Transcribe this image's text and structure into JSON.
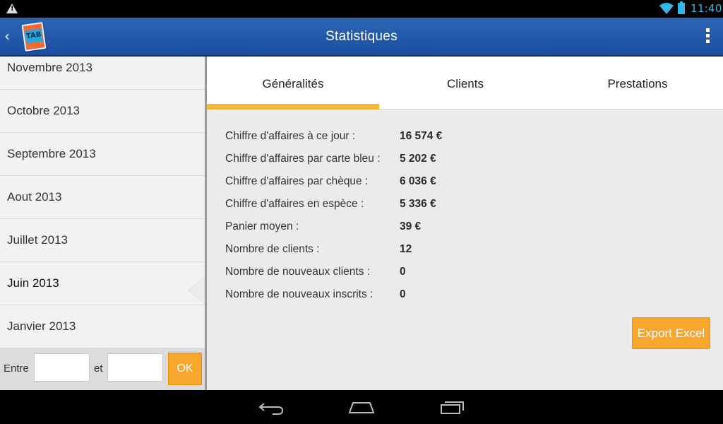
{
  "status_bar": {
    "time": "11:40",
    "icons": [
      "warning-icon",
      "wifi-icon",
      "battery-icon"
    ],
    "accent": "#33b5e5"
  },
  "action_bar": {
    "title": "Statistiques",
    "logo_text": "TAB",
    "colors": {
      "background": "#2559aa"
    }
  },
  "sidebar": {
    "months": [
      {
        "label": "Novembre 2013"
      },
      {
        "label": "Octobre 2013"
      },
      {
        "label": "Septembre 2013"
      },
      {
        "label": "Aout 2013"
      },
      {
        "label": "Juillet 2013"
      },
      {
        "label": "Juin 2013",
        "selected": true
      },
      {
        "label": "Janvier 2013"
      }
    ],
    "filter": {
      "from_label": "Entre",
      "to_label": "et",
      "from_value": "",
      "to_value": "",
      "ok_label": "OK"
    }
  },
  "tabs": [
    {
      "label": "Généralités",
      "active": true
    },
    {
      "label": "Clients",
      "active": false
    },
    {
      "label": "Prestations",
      "active": false
    }
  ],
  "stats": [
    {
      "label": "Chiffre d'affaires à ce jour :",
      "value": "16 574 €"
    },
    {
      "label": "Chiffre d'affaires par carte bleu :",
      "value": "5 202 €"
    },
    {
      "label": "Chiffre d'affaires par chèque :",
      "value": "6 036 €"
    },
    {
      "label": "Chiffre d'affaires en espèce :",
      "value": "5 336 €"
    },
    {
      "label": "Panier moyen :",
      "value": "39 €"
    },
    {
      "label": "Nombre de clients :",
      "value": "12"
    },
    {
      "label": "Nombre de nouveaux clients :",
      "value": "0"
    },
    {
      "label": "Nombre de nouveaux inscrits :",
      "value": "0"
    }
  ],
  "export_button": {
    "label": "Export Excel"
  },
  "theme": {
    "accent_orange": "#f7a62e",
    "tab_indicator": "#f5b63c"
  },
  "nav_bar": {
    "buttons": [
      "back-icon",
      "home-icon",
      "recent-apps-icon"
    ]
  }
}
